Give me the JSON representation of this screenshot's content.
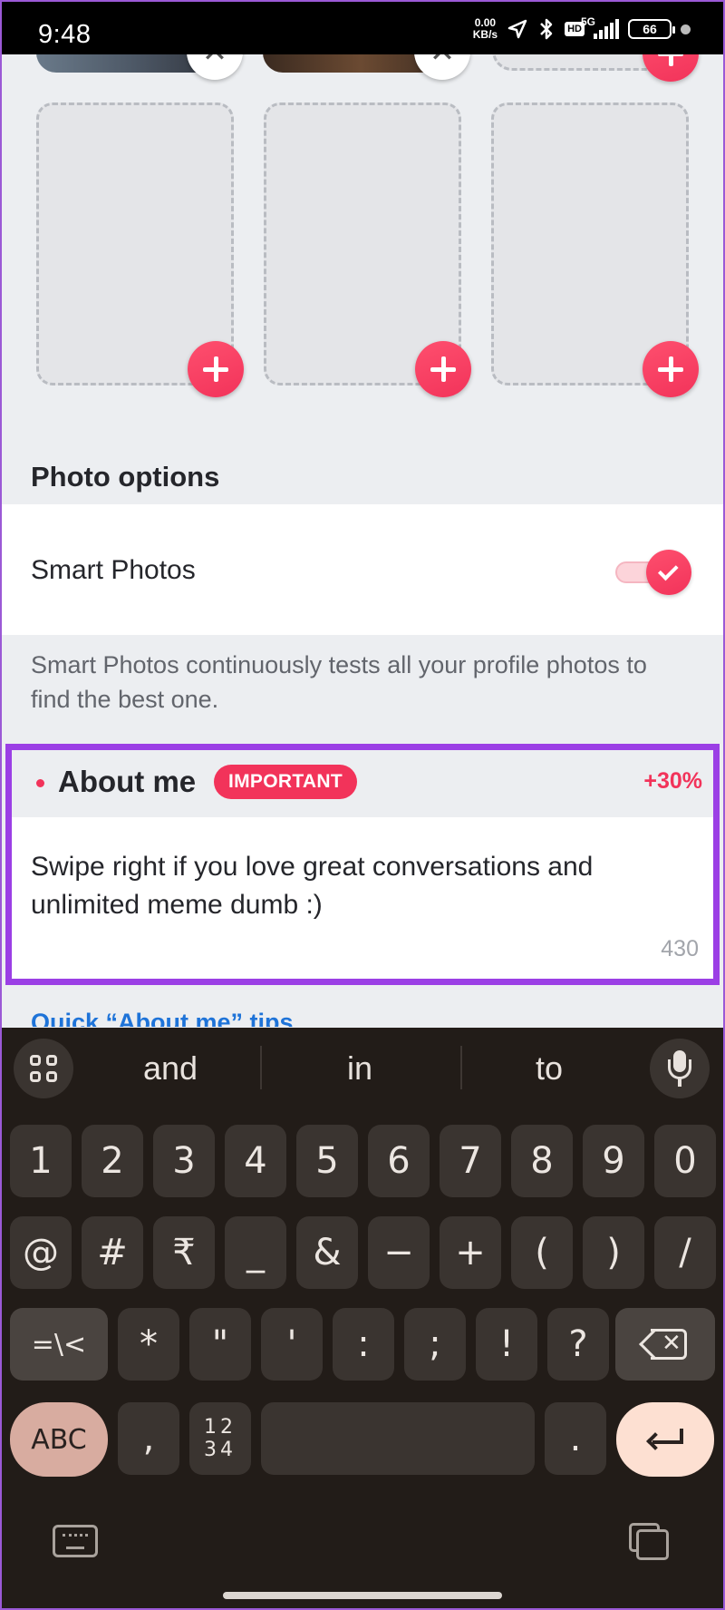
{
  "status_bar": {
    "time": "9:48",
    "net_speed_value": "0.00",
    "net_speed_unit": "KB/s",
    "hd_label": "HD",
    "signal_label": "5G",
    "battery": "66"
  },
  "photos": {
    "remove_icon": "close-icon",
    "add_icon": "plus-icon"
  },
  "photo_options": {
    "section_title": "Photo options",
    "smart_photos_label": "Smart Photos",
    "smart_photos_enabled": true,
    "smart_photos_description": "Smart Photos continuously tests all your profile photos to find the best one."
  },
  "about_me": {
    "title": "About me",
    "badge": "IMPORTANT",
    "percent": "+30%",
    "text": "Swipe right if you love great conversations and unlimited meme dumb :)",
    "char_count": "430"
  },
  "tips_link": "Quick “About me” tips",
  "keyboard": {
    "suggestions": [
      "and",
      "in",
      "to"
    ],
    "row1": [
      "1",
      "2",
      "3",
      "4",
      "5",
      "6",
      "7",
      "8",
      "9",
      "0"
    ],
    "row2": [
      "@",
      "#",
      "₹",
      "_",
      "&",
      "−",
      "+",
      "(",
      ")",
      "/"
    ],
    "row3_more": "=\\<",
    "row3": [
      "*",
      "\"",
      "'",
      ":",
      ";",
      "!",
      "?"
    ],
    "abc": "ABC",
    "comma": ",",
    "numpad_top": "12",
    "numpad_bottom": "34",
    "period": "."
  },
  "colors": {
    "brand_red": "#f2335a",
    "highlight_purple": "#9b3fe5",
    "link_blue": "#1e73d8",
    "keyboard_bg": "#221c18"
  }
}
